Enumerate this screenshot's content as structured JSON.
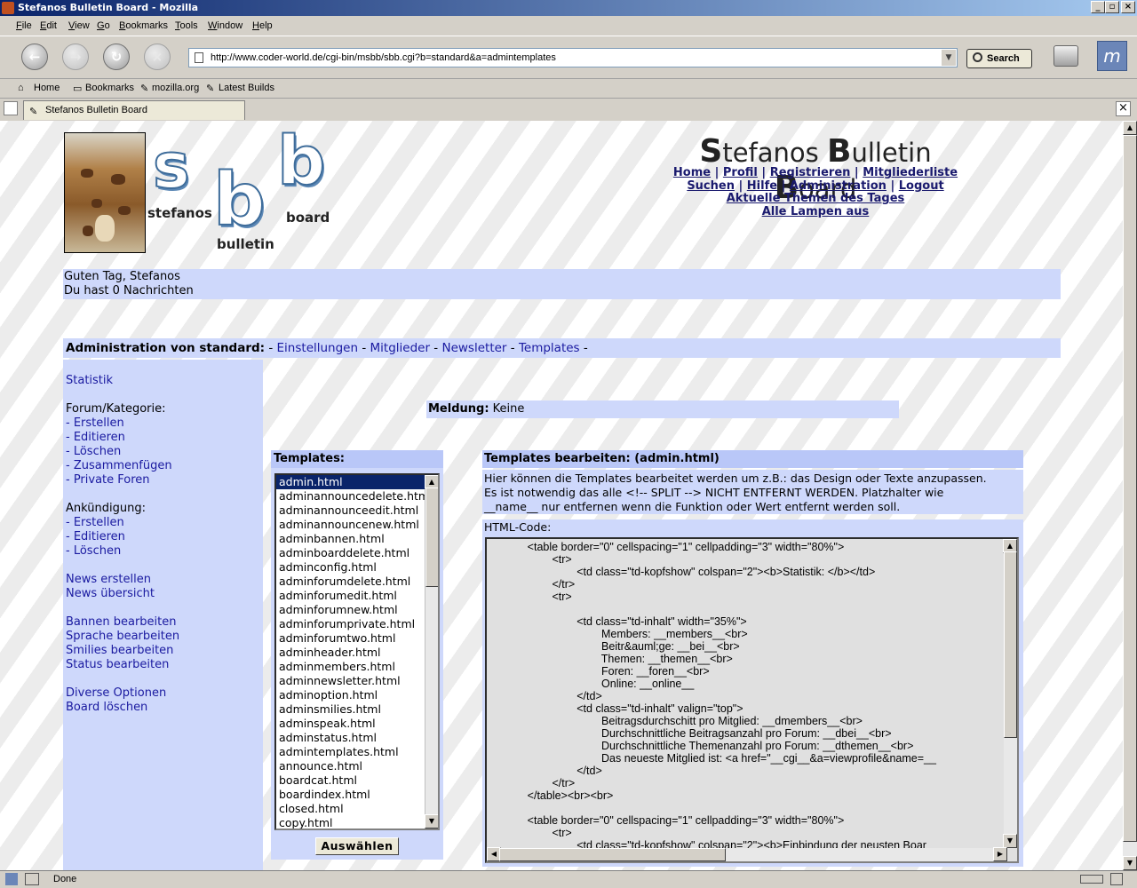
{
  "window": {
    "title": "Stefanos Bulletin Board - Mozilla",
    "minimize": "_",
    "maximize": "▫",
    "close": "×"
  },
  "menu": [
    "File",
    "Edit",
    "View",
    "Go",
    "Bookmarks",
    "Tools",
    "Window",
    "Help"
  ],
  "navigation": {
    "url": "http://www.coder-world.de/cgi-bin/msbb/sbb.cgi?b=standard&a=admintemplates",
    "search_label": "Search"
  },
  "personal_toolbar": [
    "Home",
    "Bookmarks",
    "mozilla.org",
    "Latest Builds"
  ],
  "tab": {
    "label": "Stefanos Bulletin Board"
  },
  "status": {
    "text": "Done"
  },
  "page": {
    "logo": {
      "letters": [
        "s",
        "b",
        "b"
      ],
      "words": [
        "stefanos",
        "bulletin",
        "board"
      ]
    },
    "site_title": {
      "S": "S",
      "t1": "tefanos ",
      "B1": "B",
      "t2": "ulletin ",
      "B2": "B",
      "t3": "oard"
    },
    "top_nav": {
      "row1": [
        "Home",
        "Profil",
        "Registrieren",
        "Mitgliederliste"
      ],
      "row2": [
        "Suchen",
        "Hilfe",
        "Administration",
        "Logout"
      ],
      "row3": "Aktuelle Themen des Tages",
      "row4": "Alle Lampen aus"
    },
    "greeting": [
      "Guten Tag, Stefanos",
      "Du hast 0 Nachrichten"
    ],
    "admin_bar": {
      "label": "Administration von standard:",
      "links": [
        "Einstellungen",
        "Mitglieder",
        "Newsletter",
        "Templates"
      ]
    },
    "sidebar": {
      "statistik": "Statistik",
      "forum_heading": "Forum/Kategorie:",
      "forum_items": [
        "- Erstellen",
        "- Editieren",
        "- Löschen",
        "- Zusammenfügen",
        "- Private Foren"
      ],
      "ankuendigung_heading": "Ankündigung:",
      "ankuendigung_items": [
        "- Erstellen",
        "- Editieren",
        "- Löschen"
      ],
      "news_items": [
        "News erstellen",
        "News übersicht"
      ],
      "edit_items": [
        "Bannen bearbeiten",
        "Sprache bearbeiten",
        "Smilies bearbeiten",
        "Status bearbeiten"
      ],
      "misc_items": [
        "Diverse Optionen",
        "Board löschen"
      ]
    },
    "meldung": {
      "label": "Meldung:",
      "value": "Keine"
    },
    "templates_panel": {
      "title": "Templates:",
      "items": [
        "admin.html",
        "adminannouncedelete.html",
        "adminannounceedit.html",
        "adminannouncenew.html",
        "adminbannen.html",
        "adminboarddelete.html",
        "adminconfig.html",
        "adminforumdelete.html",
        "adminforumedit.html",
        "adminforumnew.html",
        "adminforumprivate.html",
        "adminforumtwo.html",
        "adminheader.html",
        "adminmembers.html",
        "adminnewsletter.html",
        "adminoption.html",
        "adminsmilies.html",
        "adminspeak.html",
        "adminstatus.html",
        "admintemplates.html",
        "announce.html",
        "boardcat.html",
        "boardindex.html",
        "closed.html",
        "copy.html"
      ],
      "selected": "admin.html",
      "button": "Auswählen"
    },
    "editor": {
      "title": "Templates bearbeiten: (admin.html)",
      "info": [
        "Hier können die Templates bearbeitet werden um z.B.: das Design oder Texte anzupassen.",
        "Es ist notwendig das alle <!-- SPLIT --> NICHT ENTFERNT WERDEN. Platzhalter wie",
        "__name__ nur entfernen wenn die Funktion oder Wert entfernt werden soll."
      ],
      "code_label": "HTML-Code:",
      "code": "            <table border=\"0\" cellspacing=\"1\" cellpadding=\"3\" width=\"80%\">\n                    <tr>\n                            <td class=\"td-kopfshow\" colspan=\"2\"><b>Statistik: </b></td>\n                    </tr>\n                    <tr>\n\n                            <td class=\"td-inhalt\" width=\"35%\">\n                                    Members: __members__<br>\n                                    Beitr&auml;ge: __bei__<br>\n                                    Themen: __themen__<br>\n                                    Foren: __foren__<br>\n                                    Online: __online__\n                            </td>\n                            <td class=\"td-inhalt\" valign=\"top\">\n                                    Beitragsdurchschitt pro Mitglied: __dmembers__<br>\n                                    Durchschnittliche Beitragsanzahl pro Forum: __dbei__<br>\n                                    Durchschnittliche Themenanzahl pro Forum: __dthemen__<br>\n                                    Das neueste Mitglied ist: <a href=\"__cgi__&a=viewprofile&name=__\n                            </td>\n                    </tr>\n            </table><br><br>\n\n            <table border=\"0\" cellspacing=\"1\" cellpadding=\"3\" width=\"80%\">\n                    <tr>\n                            <td class=\"td-kopfshow\" colspan=\"2\"><b>Einbindung der neusten Boar"
    }
  }
}
